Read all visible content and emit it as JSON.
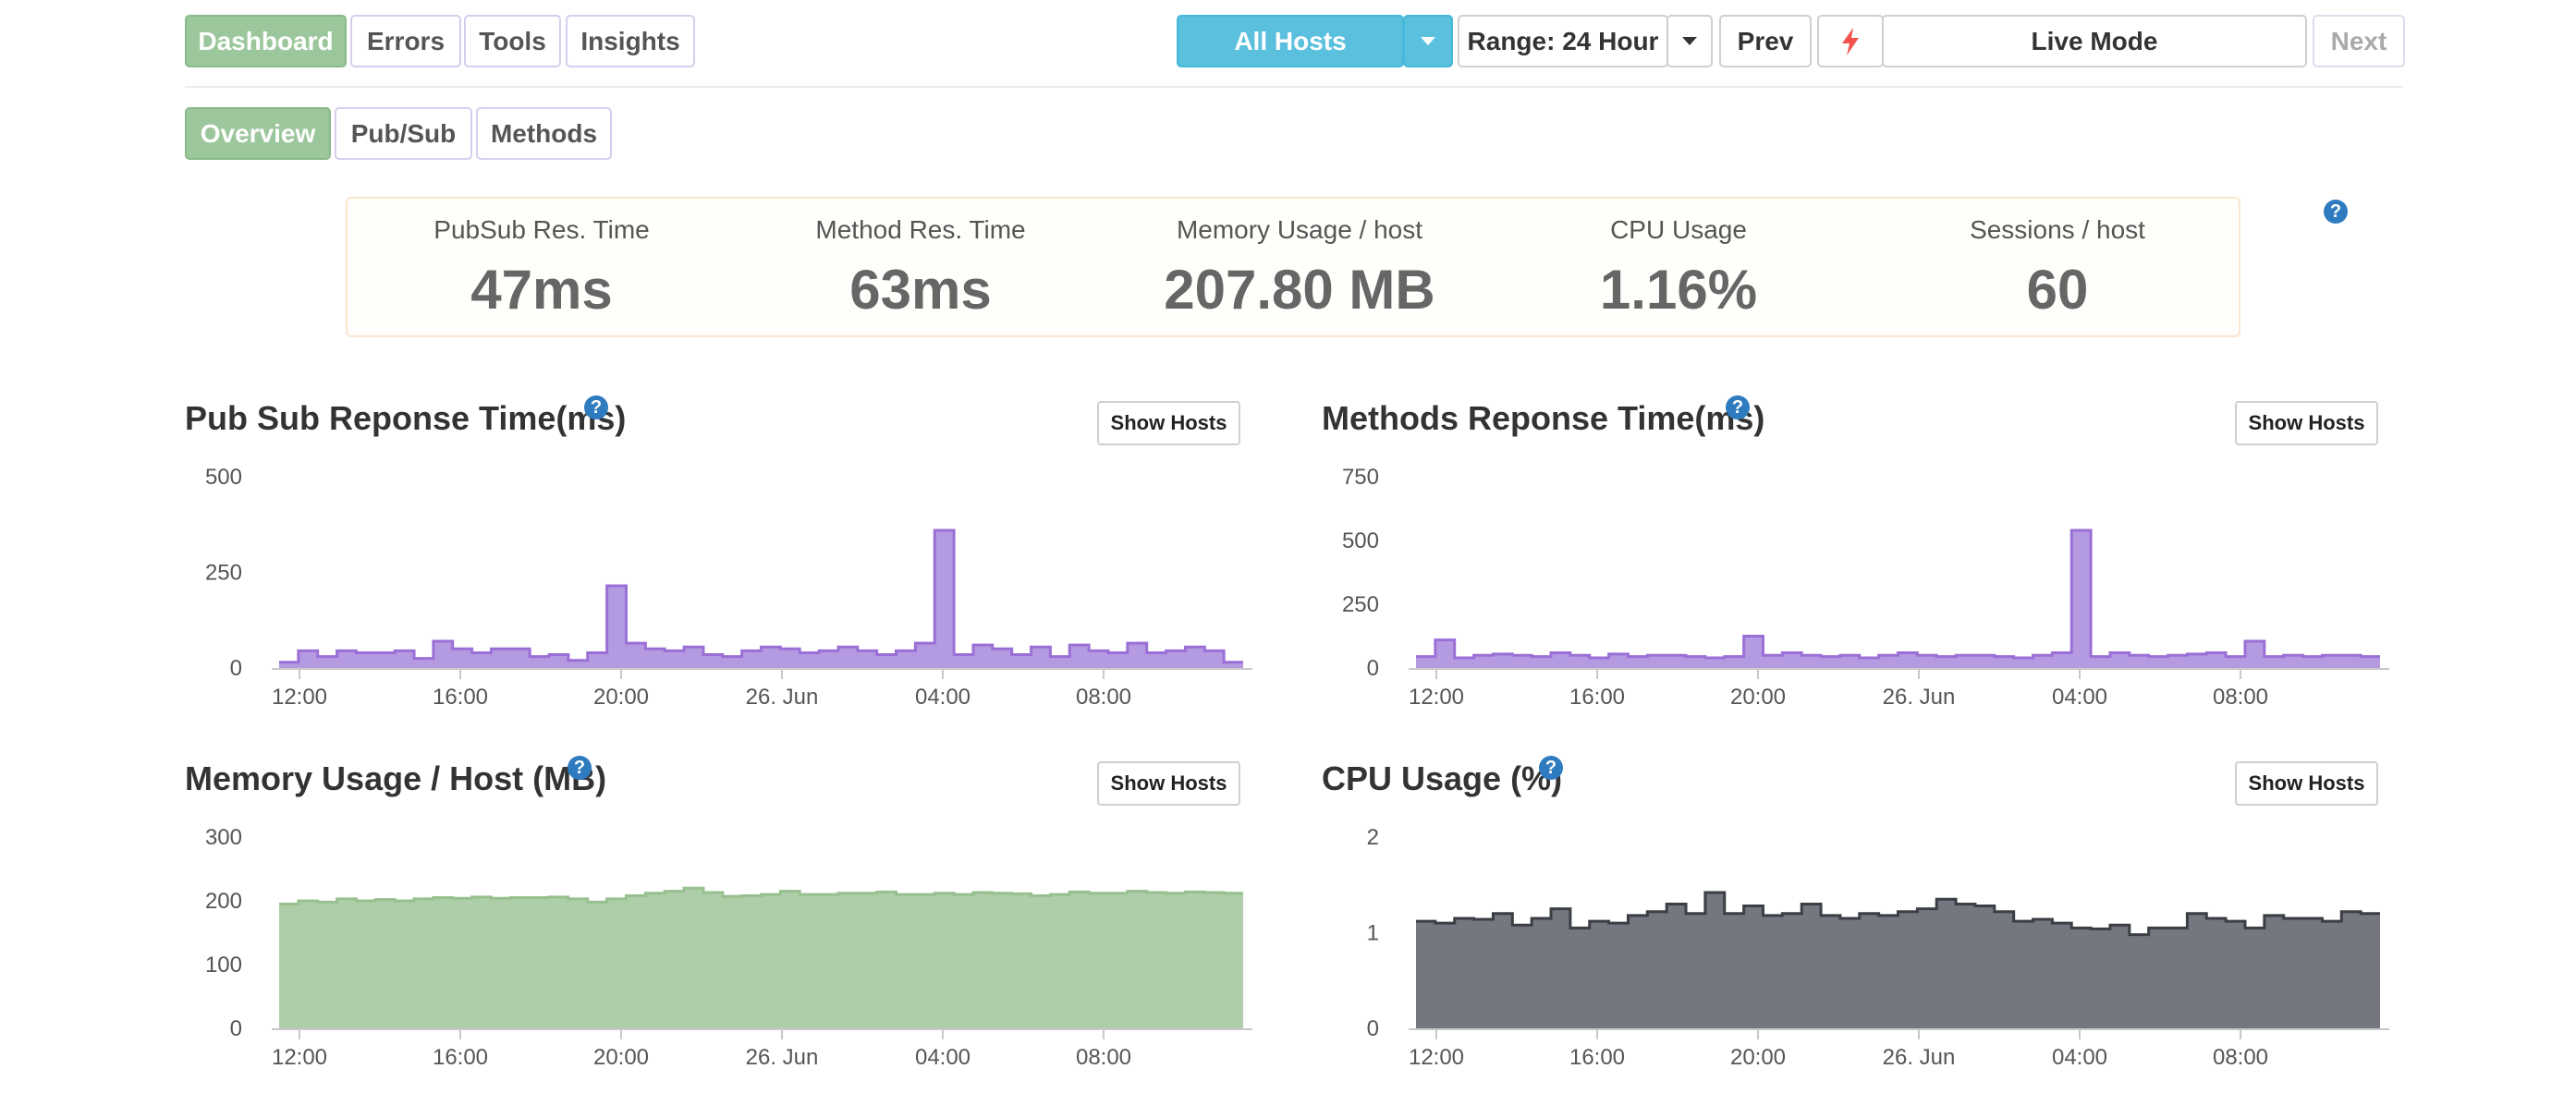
{
  "nav": {
    "tabs": [
      {
        "label": "Dashboard",
        "active": true
      },
      {
        "label": "Errors",
        "active": false
      },
      {
        "label": "Tools",
        "active": false
      },
      {
        "label": "Insights",
        "active": false
      }
    ],
    "hosts_label": "All Hosts",
    "range_label": "Range: 24 Hour",
    "prev_label": "Prev",
    "live_icon": "lightning-icon",
    "live_label": "Live Mode",
    "next_label": "Next"
  },
  "subnav": {
    "tabs": [
      {
        "label": "Overview",
        "active": true
      },
      {
        "label": "Pub/Sub",
        "active": false
      },
      {
        "label": "Methods",
        "active": false
      }
    ]
  },
  "stats": [
    {
      "label": "PubSub Res. Time",
      "value": "47ms"
    },
    {
      "label": "Method Res. Time",
      "value": "63ms"
    },
    {
      "label": "Memory Usage / host",
      "value": "207.80 MB"
    },
    {
      "label": "CPU Usage",
      "value": "1.16%"
    },
    {
      "label": "Sessions / host",
      "value": "60"
    }
  ],
  "help_symbol": "?",
  "colors": {
    "purple_fill": "#b49ae0",
    "purple_line": "#9b70d6",
    "green_fill": "#aecda9",
    "green_line": "#97c08f",
    "gray_fill": "#74777f",
    "gray_line": "#3b3e44",
    "active_tab": "#9cc79c",
    "hosts_button": "#5bc0de"
  },
  "charts": [
    {
      "title": "Pub Sub Reponse Time(ms)",
      "button": "Show Hosts"
    },
    {
      "title": "Methods Reponse Time(ms)",
      "button": "Show Hosts"
    },
    {
      "title": "Memory Usage / Host (MB)",
      "button": "Show Hosts"
    },
    {
      "title": "CPU Usage (%)",
      "button": "Show Hosts"
    }
  ],
  "chart_data": [
    {
      "type": "area",
      "title": "Pub Sub Reponse Time(ms)",
      "step": true,
      "x_ticks": [
        "12:00",
        "16:00",
        "20:00",
        "26. Jun",
        "04:00",
        "08:00"
      ],
      "y_ticks": [
        0,
        250,
        500
      ],
      "ylim": [
        0,
        500
      ],
      "values": [
        15,
        45,
        30,
        45,
        40,
        40,
        45,
        25,
        70,
        50,
        40,
        50,
        50,
        30,
        35,
        20,
        40,
        215,
        65,
        50,
        45,
        55,
        35,
        30,
        45,
        55,
        50,
        40,
        45,
        55,
        45,
        35,
        45,
        65,
        360,
        35,
        60,
        50,
        35,
        55,
        30,
        60,
        45,
        40,
        65,
        40,
        45,
        55,
        45,
        15
      ]
    },
    {
      "type": "area",
      "title": "Methods Reponse Time(ms)",
      "step": true,
      "x_ticks": [
        "12:00",
        "16:00",
        "20:00",
        "26. Jun",
        "04:00",
        "08:00"
      ],
      "y_ticks": [
        0,
        250,
        500,
        750
      ],
      "ylim": [
        0,
        750
      ],
      "values": [
        45,
        110,
        40,
        50,
        55,
        50,
        45,
        60,
        50,
        40,
        55,
        45,
        50,
        50,
        45,
        40,
        45,
        125,
        50,
        60,
        50,
        45,
        50,
        40,
        50,
        60,
        50,
        45,
        50,
        50,
        45,
        40,
        50,
        60,
        540,
        45,
        60,
        50,
        45,
        50,
        55,
        60,
        45,
        105,
        45,
        50,
        45,
        50,
        50,
        45
      ]
    },
    {
      "type": "area",
      "title": "Memory Usage / Host (MB)",
      "step": true,
      "x_ticks": [
        "12:00",
        "16:00",
        "20:00",
        "26. Jun",
        "04:00",
        "08:00"
      ],
      "y_ticks": [
        0,
        100,
        200,
        300
      ],
      "ylim": [
        0,
        300
      ],
      "values": [
        195,
        200,
        198,
        203,
        200,
        202,
        200,
        203,
        205,
        204,
        206,
        204,
        205,
        205,
        206,
        203,
        198,
        203,
        208,
        212,
        215,
        220,
        213,
        207,
        208,
        210,
        215,
        210,
        210,
        212,
        212,
        214,
        210,
        210,
        212,
        210,
        213,
        212,
        211,
        208,
        210,
        214,
        212,
        212,
        215,
        213,
        212,
        214,
        213,
        212
      ]
    },
    {
      "type": "area",
      "title": "CPU Usage (%)",
      "step": true,
      "x_ticks": [
        "12:00",
        "16:00",
        "20:00",
        "26. Jun",
        "04:00",
        "08:00"
      ],
      "y_ticks": [
        0,
        1,
        2
      ],
      "ylim": [
        0,
        2
      ],
      "values": [
        1.12,
        1.1,
        1.15,
        1.14,
        1.2,
        1.08,
        1.15,
        1.25,
        1.05,
        1.12,
        1.1,
        1.18,
        1.22,
        1.3,
        1.2,
        1.42,
        1.2,
        1.28,
        1.18,
        1.2,
        1.3,
        1.18,
        1.15,
        1.2,
        1.18,
        1.22,
        1.25,
        1.35,
        1.3,
        1.28,
        1.22,
        1.12,
        1.14,
        1.1,
        1.05,
        1.04,
        1.08,
        0.98,
        1.05,
        1.05,
        1.2,
        1.15,
        1.12,
        1.05,
        1.18,
        1.15,
        1.15,
        1.12,
        1.22,
        1.2
      ]
    }
  ]
}
